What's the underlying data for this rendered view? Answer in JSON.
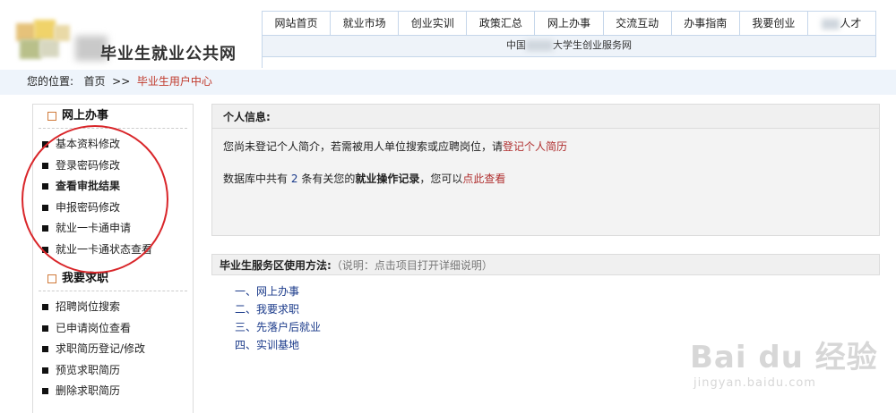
{
  "header": {
    "site_name": "毕业生就业公共网",
    "nav": [
      "网站首页",
      "就业市场",
      "创业实训",
      "政策汇总",
      "网上办事",
      "交流互动",
      "办事指南",
      "我要创业",
      "人才"
    ],
    "subnav_prefix": "中国",
    "subnav_suffix": "大学生创业服务网"
  },
  "breadcrumb": {
    "label": "您的位置:",
    "home": "首页",
    "sep": ">>",
    "current": "毕业生用户中心"
  },
  "sidebar": {
    "section1_title": "网上办事",
    "section1_items": [
      "基本资料修改",
      "登录密码修改",
      "查看审批结果",
      "申报密码修改",
      "就业一卡通申请",
      "就业一卡通状态查看"
    ],
    "section2_title": "我要求职",
    "section2_items": [
      "招聘岗位搜索",
      "已申请岗位查看",
      "求职简历登记/修改",
      "预览求职简历",
      "删除求职简历"
    ]
  },
  "main": {
    "info_title": "个人信息:",
    "line1_a": "您尚未登记个人简介，若需被用人单位搜索或应聘岗位，请",
    "line1_link": "登记个人简历",
    "line2_a": "数据库中共有",
    "line2_count": "2",
    "line2_b": "条有关您的",
    "line2_bold": "就业操作记录",
    "line2_c": "，您可以",
    "line2_link": "点此查看",
    "usage_title": "毕业生服务区使用方法:",
    "usage_note": "（说明：点击项目打开详细说明）",
    "usage_items": [
      "一、网上办事",
      "二、我要求职",
      "三、先落户后就业",
      "四、实训基地"
    ]
  },
  "watermark": {
    "big": "Bai du 经验",
    "small": "jingyan.baidu.com"
  },
  "colors": {
    "accent_red": "#b03030",
    "link_blue": "#1a3a8a",
    "ring": "#d9262a",
    "nav_border": "#c5d6ea"
  }
}
